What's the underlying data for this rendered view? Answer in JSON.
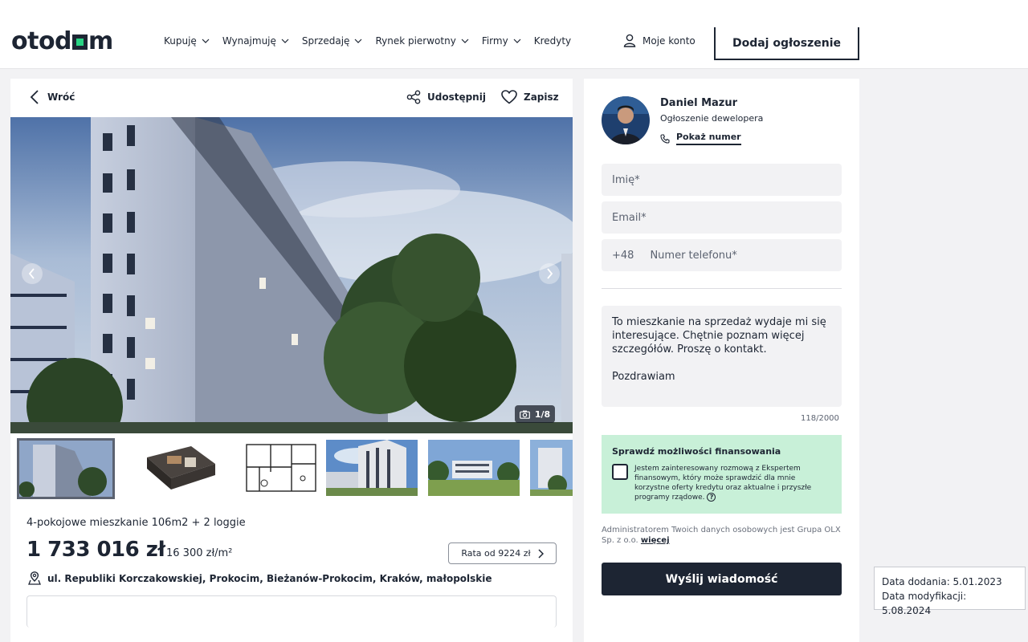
{
  "header": {
    "logo_prefix": "otod",
    "logo_suffix": "m",
    "nav": [
      {
        "label": "Kupuję",
        "dropdown": true
      },
      {
        "label": "Wynajmuję",
        "dropdown": true
      },
      {
        "label": "Sprzedaję",
        "dropdown": true
      },
      {
        "label": "Rynek pierwotny",
        "dropdown": true
      },
      {
        "label": "Firmy",
        "dropdown": true
      },
      {
        "label": "Kredyty",
        "dropdown": false
      }
    ],
    "account_label": "Moje konto",
    "add_listing_label": "Dodaj ogłoszenie"
  },
  "listing": {
    "back_label": "Wróć",
    "share_label": "Udostępnij",
    "save_label": "Zapisz",
    "photo_counter": "1/8",
    "thumbnail_count": 6,
    "title": "4-pokojowe mieszkanie 106m2 + 2 loggie",
    "price": "1 733 016 zł",
    "price_per_m2": "16 300 zł/m²",
    "installment_label": "Rata od 9224 zł",
    "address": "ul. Republiki Korczakowskiej, Prokocim, Bieżanów-Prokocim, Kraków, małopolskie"
  },
  "contact": {
    "agent_name": "Daniel Mazur",
    "agent_type": "Ogłoszenie dewelopera",
    "show_number_label": "Pokaż numer",
    "name_placeholder": "Imię*",
    "email_placeholder": "Email*",
    "phone_prefix": "+48",
    "phone_placeholder": "Numer telefonu*",
    "message": "To mieszkanie na sprzedaż wydaje mi się interesujące. Chętnie poznam więcej szczegółów. Proszę o kontakt.\n\nPozdrawiam",
    "char_count": "118/2000",
    "finance_title": "Sprawdź możliwości finansowania",
    "finance_text": "Jestem zainteresowany rozmową z Ekspertem finansowym, który może sprawdzić dla mnie korzystne oferty kredytu oraz aktualne i przyszłe programy rządowe.",
    "admin_text": "Administratorem Twoich danych osobowych jest Grupa OLX Sp. z o.o.",
    "admin_link": "więcej",
    "send_label": "Wyślij wiadomość"
  },
  "dates": {
    "added": "Data dodania: 5.01.2023",
    "modified": "Data modyfikacji: 5.08.2024"
  },
  "colors": {
    "primary": "#1d2533",
    "accent_green": "#28d383",
    "finance_bg": "#c8f0d8"
  }
}
